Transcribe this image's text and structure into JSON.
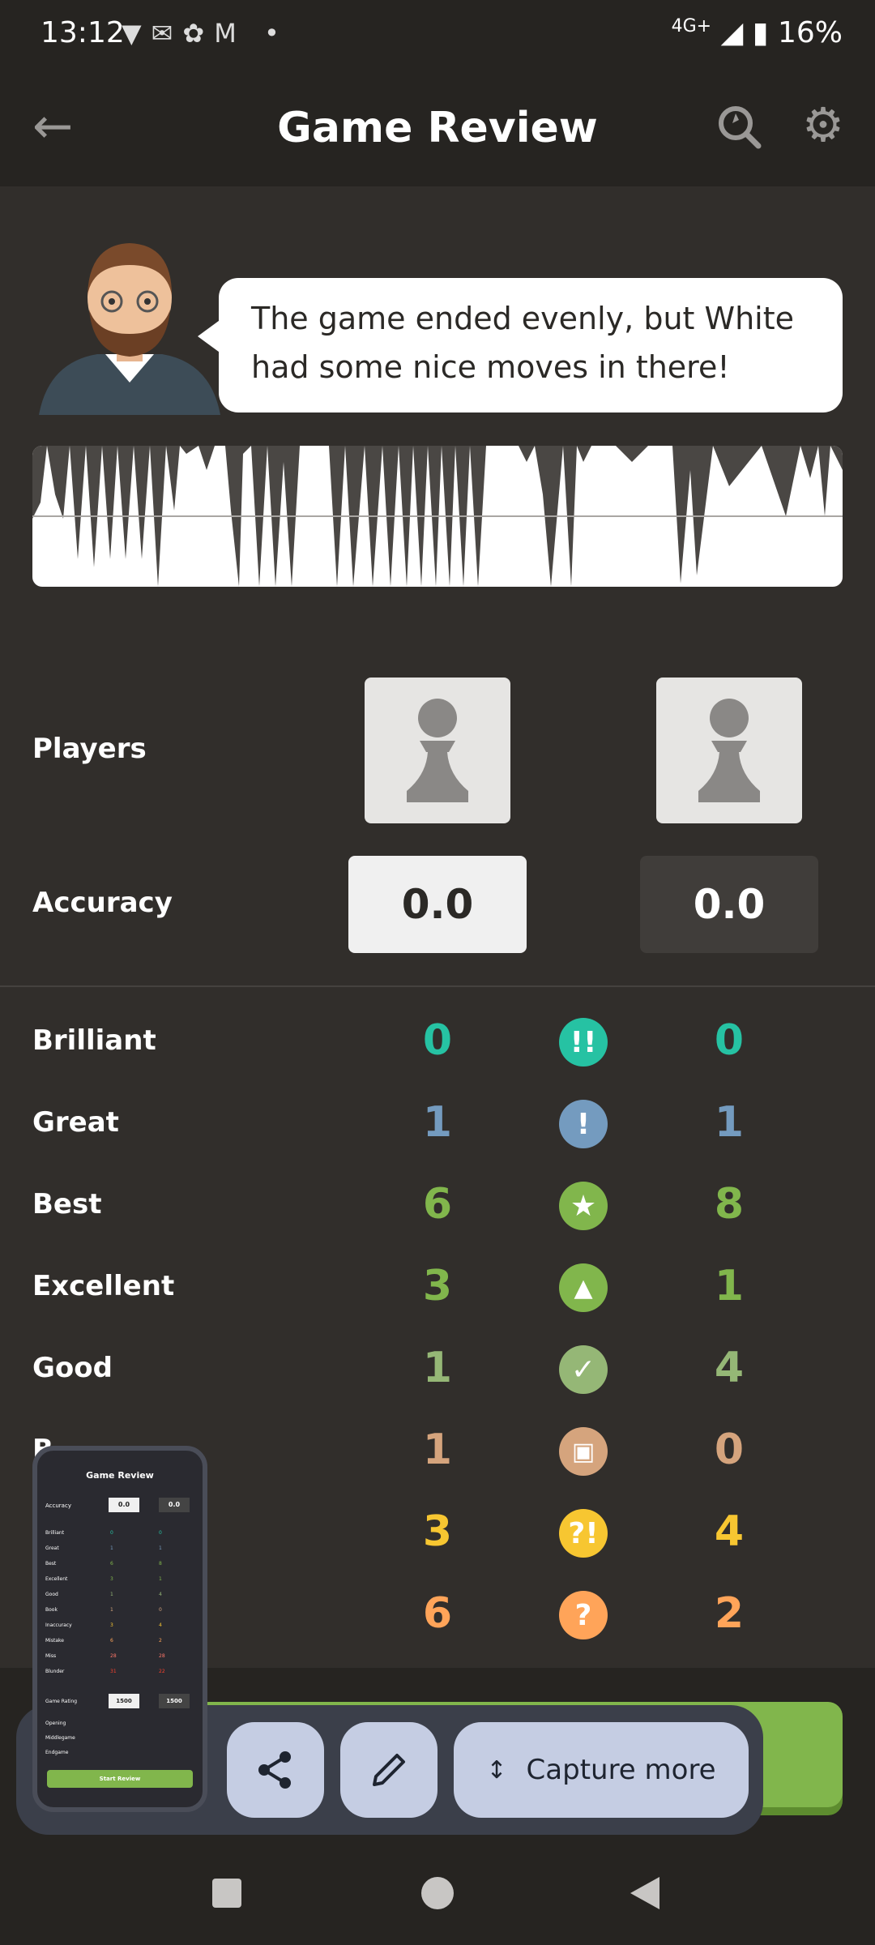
{
  "status_bar": {
    "time": "13:12",
    "network": "4G+",
    "battery": "16%"
  },
  "header": {
    "title": "Game Review"
  },
  "coach": {
    "message": "The game ended evenly, but White had some nice moves in there!"
  },
  "labels": {
    "players": "Players",
    "accuracy": "Accuracy"
  },
  "accuracy": {
    "white": "0.0",
    "black": "0.0"
  },
  "move_rows": [
    {
      "label": "Brilliant",
      "white": "0",
      "black": "0",
      "icon": "!!",
      "color": "#26c2a3"
    },
    {
      "label": "Great",
      "white": "1",
      "black": "1",
      "icon": "!",
      "color": "#749bbf"
    },
    {
      "label": "Best",
      "white": "6",
      "black": "8",
      "icon": "★",
      "color": "#81b64c"
    },
    {
      "label": "Excellent",
      "white": "3",
      "black": "1",
      "icon": "👍",
      "color": "#81b64c"
    },
    {
      "label": "Good",
      "white": "1",
      "black": "4",
      "icon": "✓",
      "color": "#95b776"
    },
    {
      "label": "Book",
      "visible_label": "B...",
      "white": "1",
      "black": "0",
      "icon": "📖",
      "color": "#d5a47d"
    },
    {
      "label": "Inaccuracy",
      "white": "3",
      "black": "4",
      "icon": "?!",
      "color": "#f7c631"
    },
    {
      "label": "Mistake",
      "white": "6",
      "black": "2",
      "icon": "?",
      "color": "#ffa459"
    }
  ],
  "capture_toolbar": {
    "capture_more_label": "Capture more"
  },
  "thumbnail": {
    "title": "Game Review",
    "accuracy_label": "Accuracy",
    "acc_white": "0.0",
    "acc_black": "0.0",
    "rows": [
      {
        "label": "Brilliant",
        "w": "0",
        "b": "0"
      },
      {
        "label": "Great",
        "w": "1",
        "b": "1"
      },
      {
        "label": "Best",
        "w": "6",
        "b": "8"
      },
      {
        "label": "Excellent",
        "w": "3",
        "b": "1"
      },
      {
        "label": "Good",
        "w": "1",
        "b": "4"
      },
      {
        "label": "Book",
        "w": "1",
        "b": "0"
      },
      {
        "label": "Inaccuracy",
        "w": "3",
        "b": "4"
      },
      {
        "label": "Mistake",
        "w": "6",
        "b": "2"
      },
      {
        "label": "Miss",
        "w": "28",
        "b": "28"
      },
      {
        "label": "Blunder",
        "w": "31",
        "b": "22"
      }
    ],
    "game_rating_label": "Game Rating",
    "rating_white": "1500",
    "rating_black": "1500",
    "phases": [
      "Opening",
      "Middlegame",
      "Endgame"
    ],
    "start_review": "Start Review"
  }
}
